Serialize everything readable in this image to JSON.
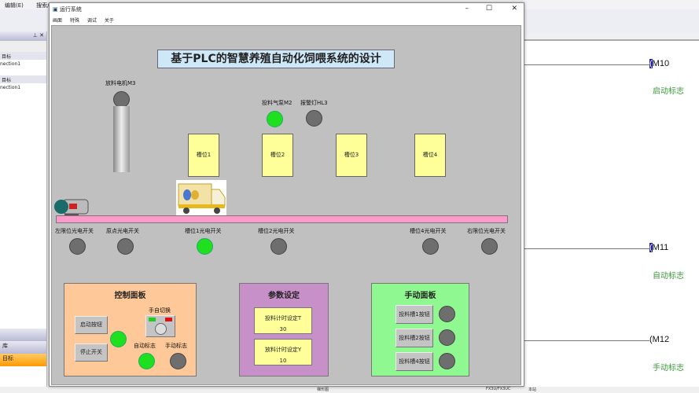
{
  "app": {
    "menu": [
      "编辑(E)",
      "搜索/替换(S)"
    ]
  },
  "sidebar": {
    "section1": "目标",
    "item1": "nection1",
    "section2": "目标",
    "item2": "nection1",
    "bottom_items": [
      "库",
      "目标"
    ]
  },
  "window": {
    "title": "运行系统",
    "menu": [
      "画面",
      "特殊",
      "调试",
      "关于"
    ],
    "minimize": "–",
    "maximize": "☐",
    "close": "✕"
  },
  "hmi": {
    "title": "基于PLC的智慧养殖自动化饲喂系统的设计",
    "motor_m3": "放料电机M3",
    "pump_m2": "投料气泵M2",
    "alarm_l3": "报警灯HL3",
    "pump_on": true,
    "alarm_on": false,
    "motor_on": false,
    "slots": [
      "槽位1",
      "槽位2",
      "槽位3",
      "槽位4"
    ],
    "sensors": [
      {
        "label": "左限位光电开关",
        "on": false
      },
      {
        "label": "原点光电开关",
        "on": false
      },
      {
        "label": "槽位1光电开关",
        "on": true
      },
      {
        "label": "槽位2光电开关",
        "on": false
      },
      {
        "label": "槽位4光电开关",
        "on": false
      },
      {
        "label": "右限位光电开关",
        "on": false
      }
    ],
    "control": {
      "title": "控制面板",
      "start": "启动按钮",
      "stop": "停止开关",
      "switch": "手自切换",
      "auto": "自动标志",
      "manual": "手动标志",
      "run_on": true,
      "auto_on": true,
      "manual_on": false
    },
    "params": {
      "title": "参数设定",
      "t_label": "投料计时设定T",
      "t_value": "30",
      "y_label": "放料计时设定Y",
      "y_value": "10"
    },
    "manual": {
      "title": "手动面板",
      "buttons": [
        "投料槽1按钮",
        "投料槽2按钮",
        "投料槽4按钮"
      ]
    }
  },
  "ladder": {
    "coils": [
      {
        "name": "M10",
        "comment": "启动标志"
      },
      {
        "name": "M11",
        "comment": "自动标志"
      },
      {
        "name": "M12",
        "comment": "手动标志"
      }
    ]
  },
  "status": {
    "items": [
      "梯形图",
      "FX3U/FX3UC",
      "本站"
    ]
  },
  "colors": {
    "lamp_on": "#1ee01e",
    "lamp_off": "#6e6e6e",
    "control_panel": "#ffc898",
    "param_panel": "#c890c8",
    "manual_panel": "#90f890",
    "conveyor": "#ff99cc"
  }
}
